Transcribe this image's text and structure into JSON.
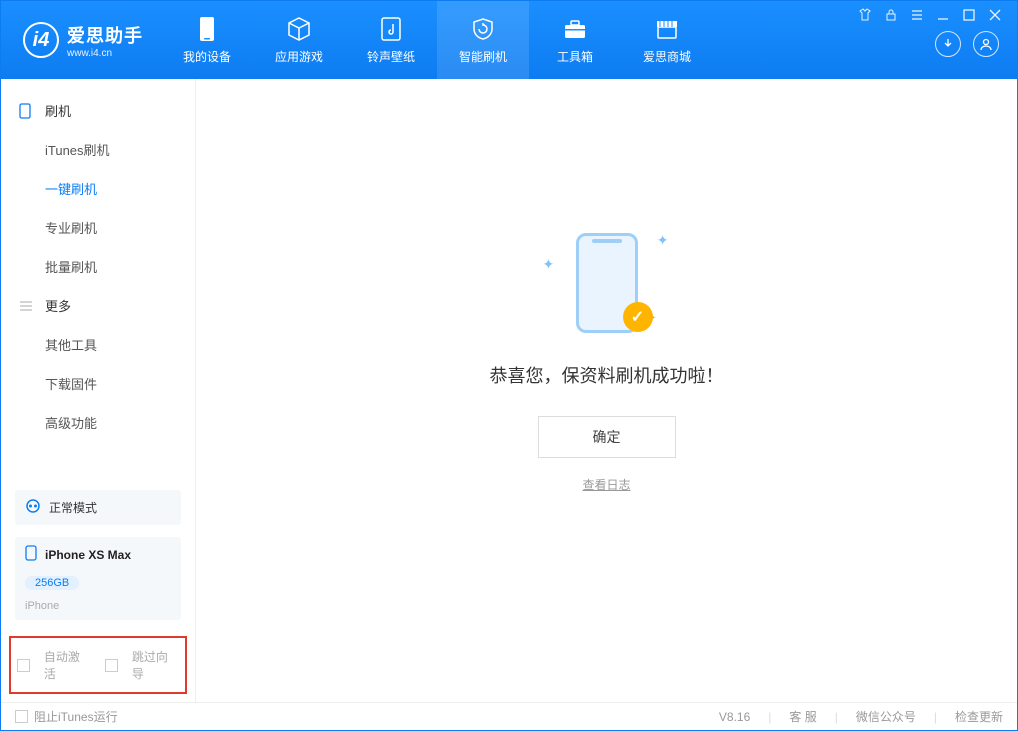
{
  "app": {
    "title": "爱思助手",
    "subtitle": "www.i4.cn"
  },
  "nav": {
    "tabs": [
      {
        "label": "我的设备"
      },
      {
        "label": "应用游戏"
      },
      {
        "label": "铃声壁纸"
      },
      {
        "label": "智能刷机"
      },
      {
        "label": "工具箱"
      },
      {
        "label": "爱思商城"
      }
    ]
  },
  "sidebar": {
    "group1_title": "刷机",
    "group1_items": [
      "iTunes刷机",
      "一键刷机",
      "专业刷机",
      "批量刷机"
    ],
    "group2_title": "更多",
    "group2_items": [
      "其他工具",
      "下载固件",
      "高级功能"
    ]
  },
  "device": {
    "mode_label": "正常模式",
    "name": "iPhone XS Max",
    "storage": "256GB",
    "type": "iPhone"
  },
  "options": {
    "auto_activate": "自动激活",
    "skip_guide": "跳过向导"
  },
  "main": {
    "success_text": "恭喜您，保资料刷机成功啦！",
    "ok_button": "确定",
    "view_log": "查看日志"
  },
  "footer": {
    "block_itunes": "阻止iTunes运行",
    "version": "V8.16",
    "support": "客 服",
    "wechat": "微信公众号",
    "check_update": "检查更新"
  }
}
